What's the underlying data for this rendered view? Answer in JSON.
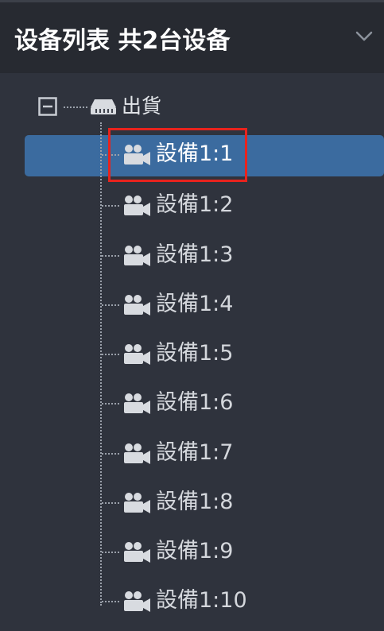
{
  "panel": {
    "title": "设备列表 共2台设备"
  },
  "tree": {
    "root": {
      "label": "出貨",
      "expanded": true
    },
    "selected_index": 0,
    "devices": [
      {
        "label": "設備1:1"
      },
      {
        "label": "設備1:2"
      },
      {
        "label": "設備1:3"
      },
      {
        "label": "設備1:4"
      },
      {
        "label": "設備1:5"
      },
      {
        "label": "設備1:6"
      },
      {
        "label": "設備1:7"
      },
      {
        "label": "設備1:8"
      },
      {
        "label": "設備1:9"
      },
      {
        "label": "設備1:10"
      }
    ]
  },
  "colors": {
    "panel_bg": "#2f333d",
    "header_bg": "#272a31",
    "selection_bg": "#3b6b9f",
    "highlight_outline": "#e8231d",
    "text": "#d4d7dc"
  }
}
